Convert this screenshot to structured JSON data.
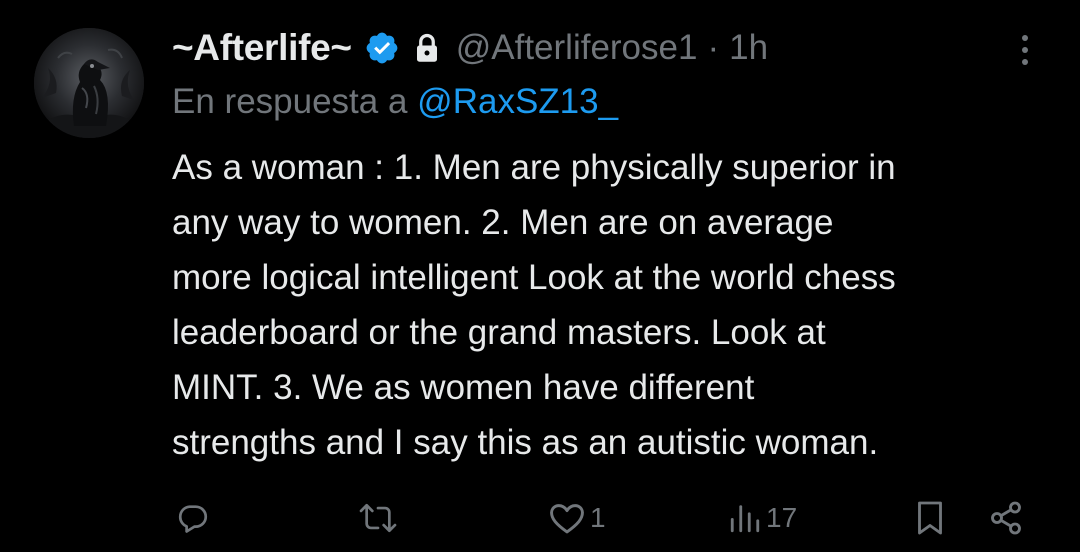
{
  "author": {
    "display_name": "~Afterlife~",
    "handle": "@Afterliferose1",
    "separator": "·",
    "time": "1h",
    "verified_icon": "verified-badge-icon",
    "lock_icon": "lock-icon",
    "avatar_icon": "raven-avatar"
  },
  "reply": {
    "prefix": "En respuesta a",
    "mention": "@RaxSZ13_"
  },
  "body": {
    "text": "As a woman : 1. Men are physically superior in\nany way to women. 2. Men are on average\nmore logical intelligent Look at the world chess\nleaderboard or the grand masters. Look at\nMINT. 3. We as women have different\nstrengths and I say this as an autistic woman."
  },
  "actions": {
    "reply": {
      "icon": "reply-icon",
      "count": ""
    },
    "repost": {
      "icon": "repost-icon",
      "count": ""
    },
    "like": {
      "icon": "heart-icon",
      "count": "1"
    },
    "views": {
      "icon": "views-icon",
      "count": "17"
    },
    "bookmark": {
      "icon": "bookmark-icon"
    },
    "share": {
      "icon": "share-icon"
    }
  },
  "colors": {
    "background": "#000000",
    "primary_text": "#e7e9ea",
    "secondary_text": "#71767b",
    "accent": "#1d9bf0"
  }
}
